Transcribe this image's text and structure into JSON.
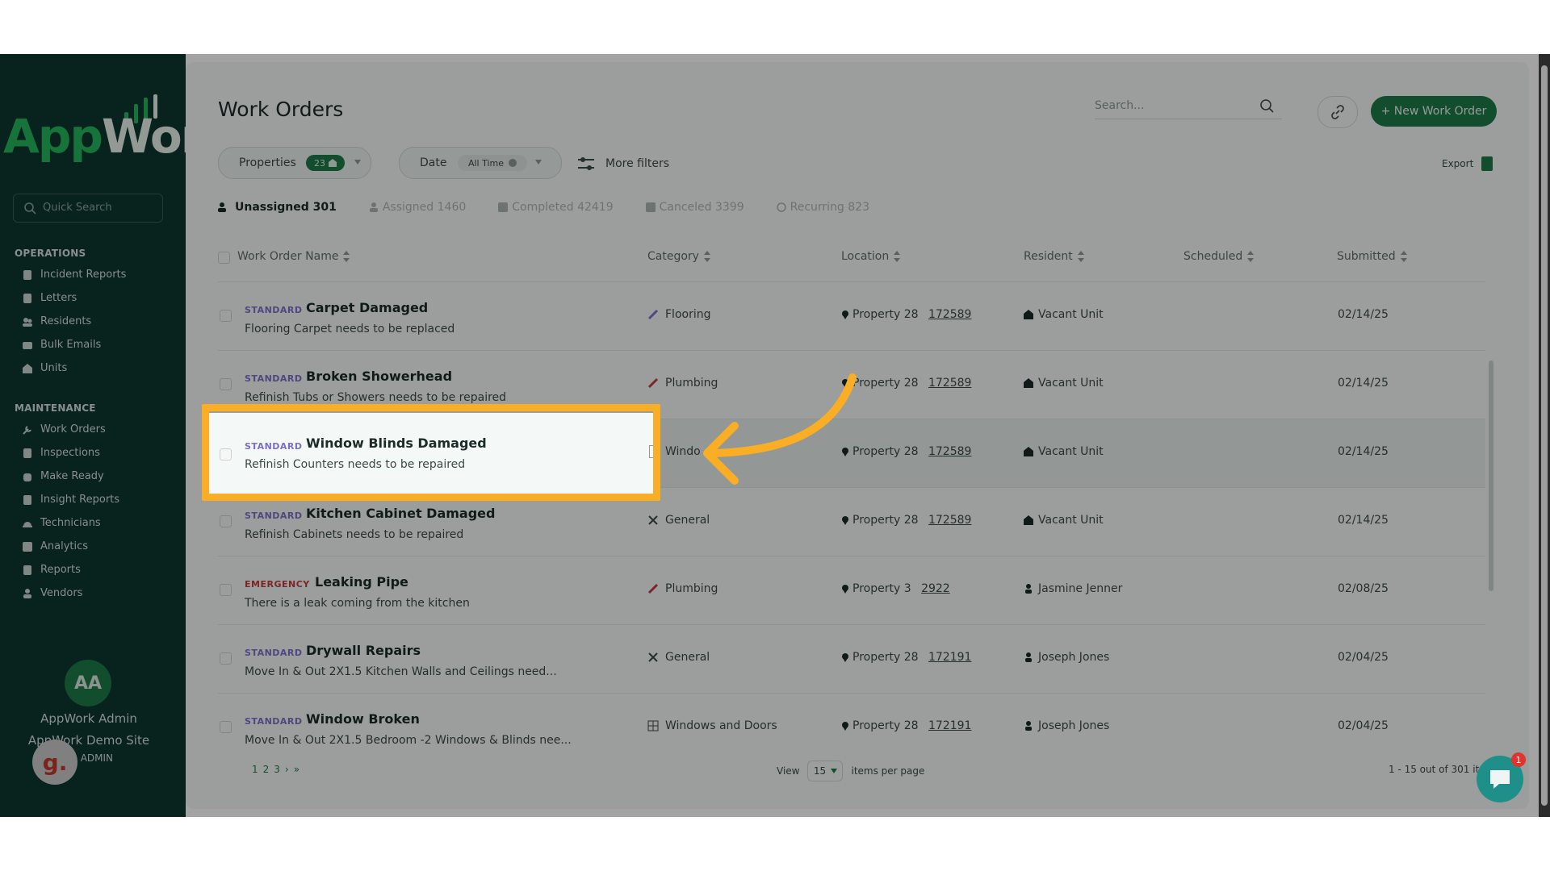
{
  "sidebar": {
    "logo_app": "App",
    "logo_work": "Work",
    "quick_search_placeholder": "Quick Search",
    "sections": [
      {
        "title": "OPERATIONS",
        "items": [
          "Incident Reports",
          "Letters",
          "Residents",
          "Bulk Emails",
          "Units"
        ]
      },
      {
        "title": "MAINTENANCE",
        "items": [
          "Work Orders",
          "Inspections",
          "Make Ready",
          "Insight Reports",
          "Technicians",
          "Analytics",
          "Reports",
          "Vendors"
        ]
      }
    ],
    "user": {
      "initials": "AA",
      "name": "AppWork Admin",
      "site": "AppWork Demo Site",
      "role": "ER ADMIN",
      "badge": "g."
    }
  },
  "header": {
    "title": "Work Orders",
    "search_placeholder": "Search...",
    "new_button": "+ New Work Order",
    "export": "Export"
  },
  "filters": {
    "properties_label": "Properties",
    "properties_count": "23",
    "date_label": "Date",
    "date_value": "All Time",
    "more_filters": "More filters"
  },
  "tabs": [
    {
      "label": "Unassigned 301",
      "active": true
    },
    {
      "label": "Assigned 1460",
      "active": false
    },
    {
      "label": "Completed 42419",
      "active": false
    },
    {
      "label": "Canceled 3399",
      "active": false
    },
    {
      "label": "Recurring 823",
      "active": false
    }
  ],
  "table": {
    "columns": [
      "Work Order Name",
      "Category",
      "Location",
      "Resident",
      "Scheduled",
      "Submitted"
    ],
    "rows": [
      {
        "priority": "STANDARD",
        "name": "Carpet Damaged",
        "desc": "Flooring Carpet needs to be replaced",
        "category": "Flooring",
        "location": "Property 28",
        "unit": "172589",
        "resident": "Vacant Unit",
        "scheduled": "",
        "submitted": "02/14/25"
      },
      {
        "priority": "STANDARD",
        "name": "Broken Showerhead",
        "desc": "Refinish Tubs or Showers needs to be repaired",
        "category": "Plumbing",
        "location": "Property 28",
        "unit": "172589",
        "resident": "Vacant Unit",
        "scheduled": "",
        "submitted": "02/14/25"
      },
      {
        "priority": "STANDARD",
        "name": "Window Blinds Damaged",
        "desc": "Refinish Counters needs to be repaired",
        "category": "Windo",
        "location": "Property 28",
        "unit": "172589",
        "resident": "Vacant Unit",
        "scheduled": "",
        "submitted": "02/14/25"
      },
      {
        "priority": "STANDARD",
        "name": "Kitchen Cabinet Damaged",
        "desc": "Refinish Cabinets needs to be repaired",
        "category": "General",
        "location": "Property 28",
        "unit": "172589",
        "resident": "Vacant Unit",
        "scheduled": "",
        "submitted": "02/14/25"
      },
      {
        "priority": "EMERGENCY",
        "name": "Leaking Pipe",
        "desc": "There is a leak coming from the kitchen",
        "category": "Plumbing",
        "location": "Property 3",
        "unit": "2922",
        "resident": "Jasmine Jenner",
        "scheduled": "",
        "submitted": "02/08/25"
      },
      {
        "priority": "STANDARD",
        "name": "Drywall Repairs",
        "desc": "Move In & Out 2X1.5 Kitchen Walls and Ceilings need...",
        "category": "General",
        "location": "Property 28",
        "unit": "172191",
        "resident": "Joseph Jones",
        "scheduled": "",
        "submitted": "02/04/25"
      },
      {
        "priority": "STANDARD",
        "name": "Window Broken",
        "desc": "Move In & Out 2X1.5 Bedroom -2 Windows & Blinds nee...",
        "category": "Windows and Doors",
        "location": "Property 28",
        "unit": "172191",
        "resident": "Joseph Jones",
        "scheduled": "",
        "submitted": "02/04/25"
      }
    ]
  },
  "footer": {
    "pages": [
      "1",
      "2",
      "3",
      "›",
      "»"
    ],
    "view_label": "View",
    "per_page_value": "15",
    "per_page_label": "items per page",
    "range": "1 - 15 out of 301 it"
  },
  "chat": {
    "badge": "1"
  },
  "colors": {
    "brand": "#1d7a48",
    "sidebar": "#0d3630",
    "highlight": "#f9ae25",
    "standard": "#7a6fc9",
    "emergency": "#c43b3b"
  }
}
